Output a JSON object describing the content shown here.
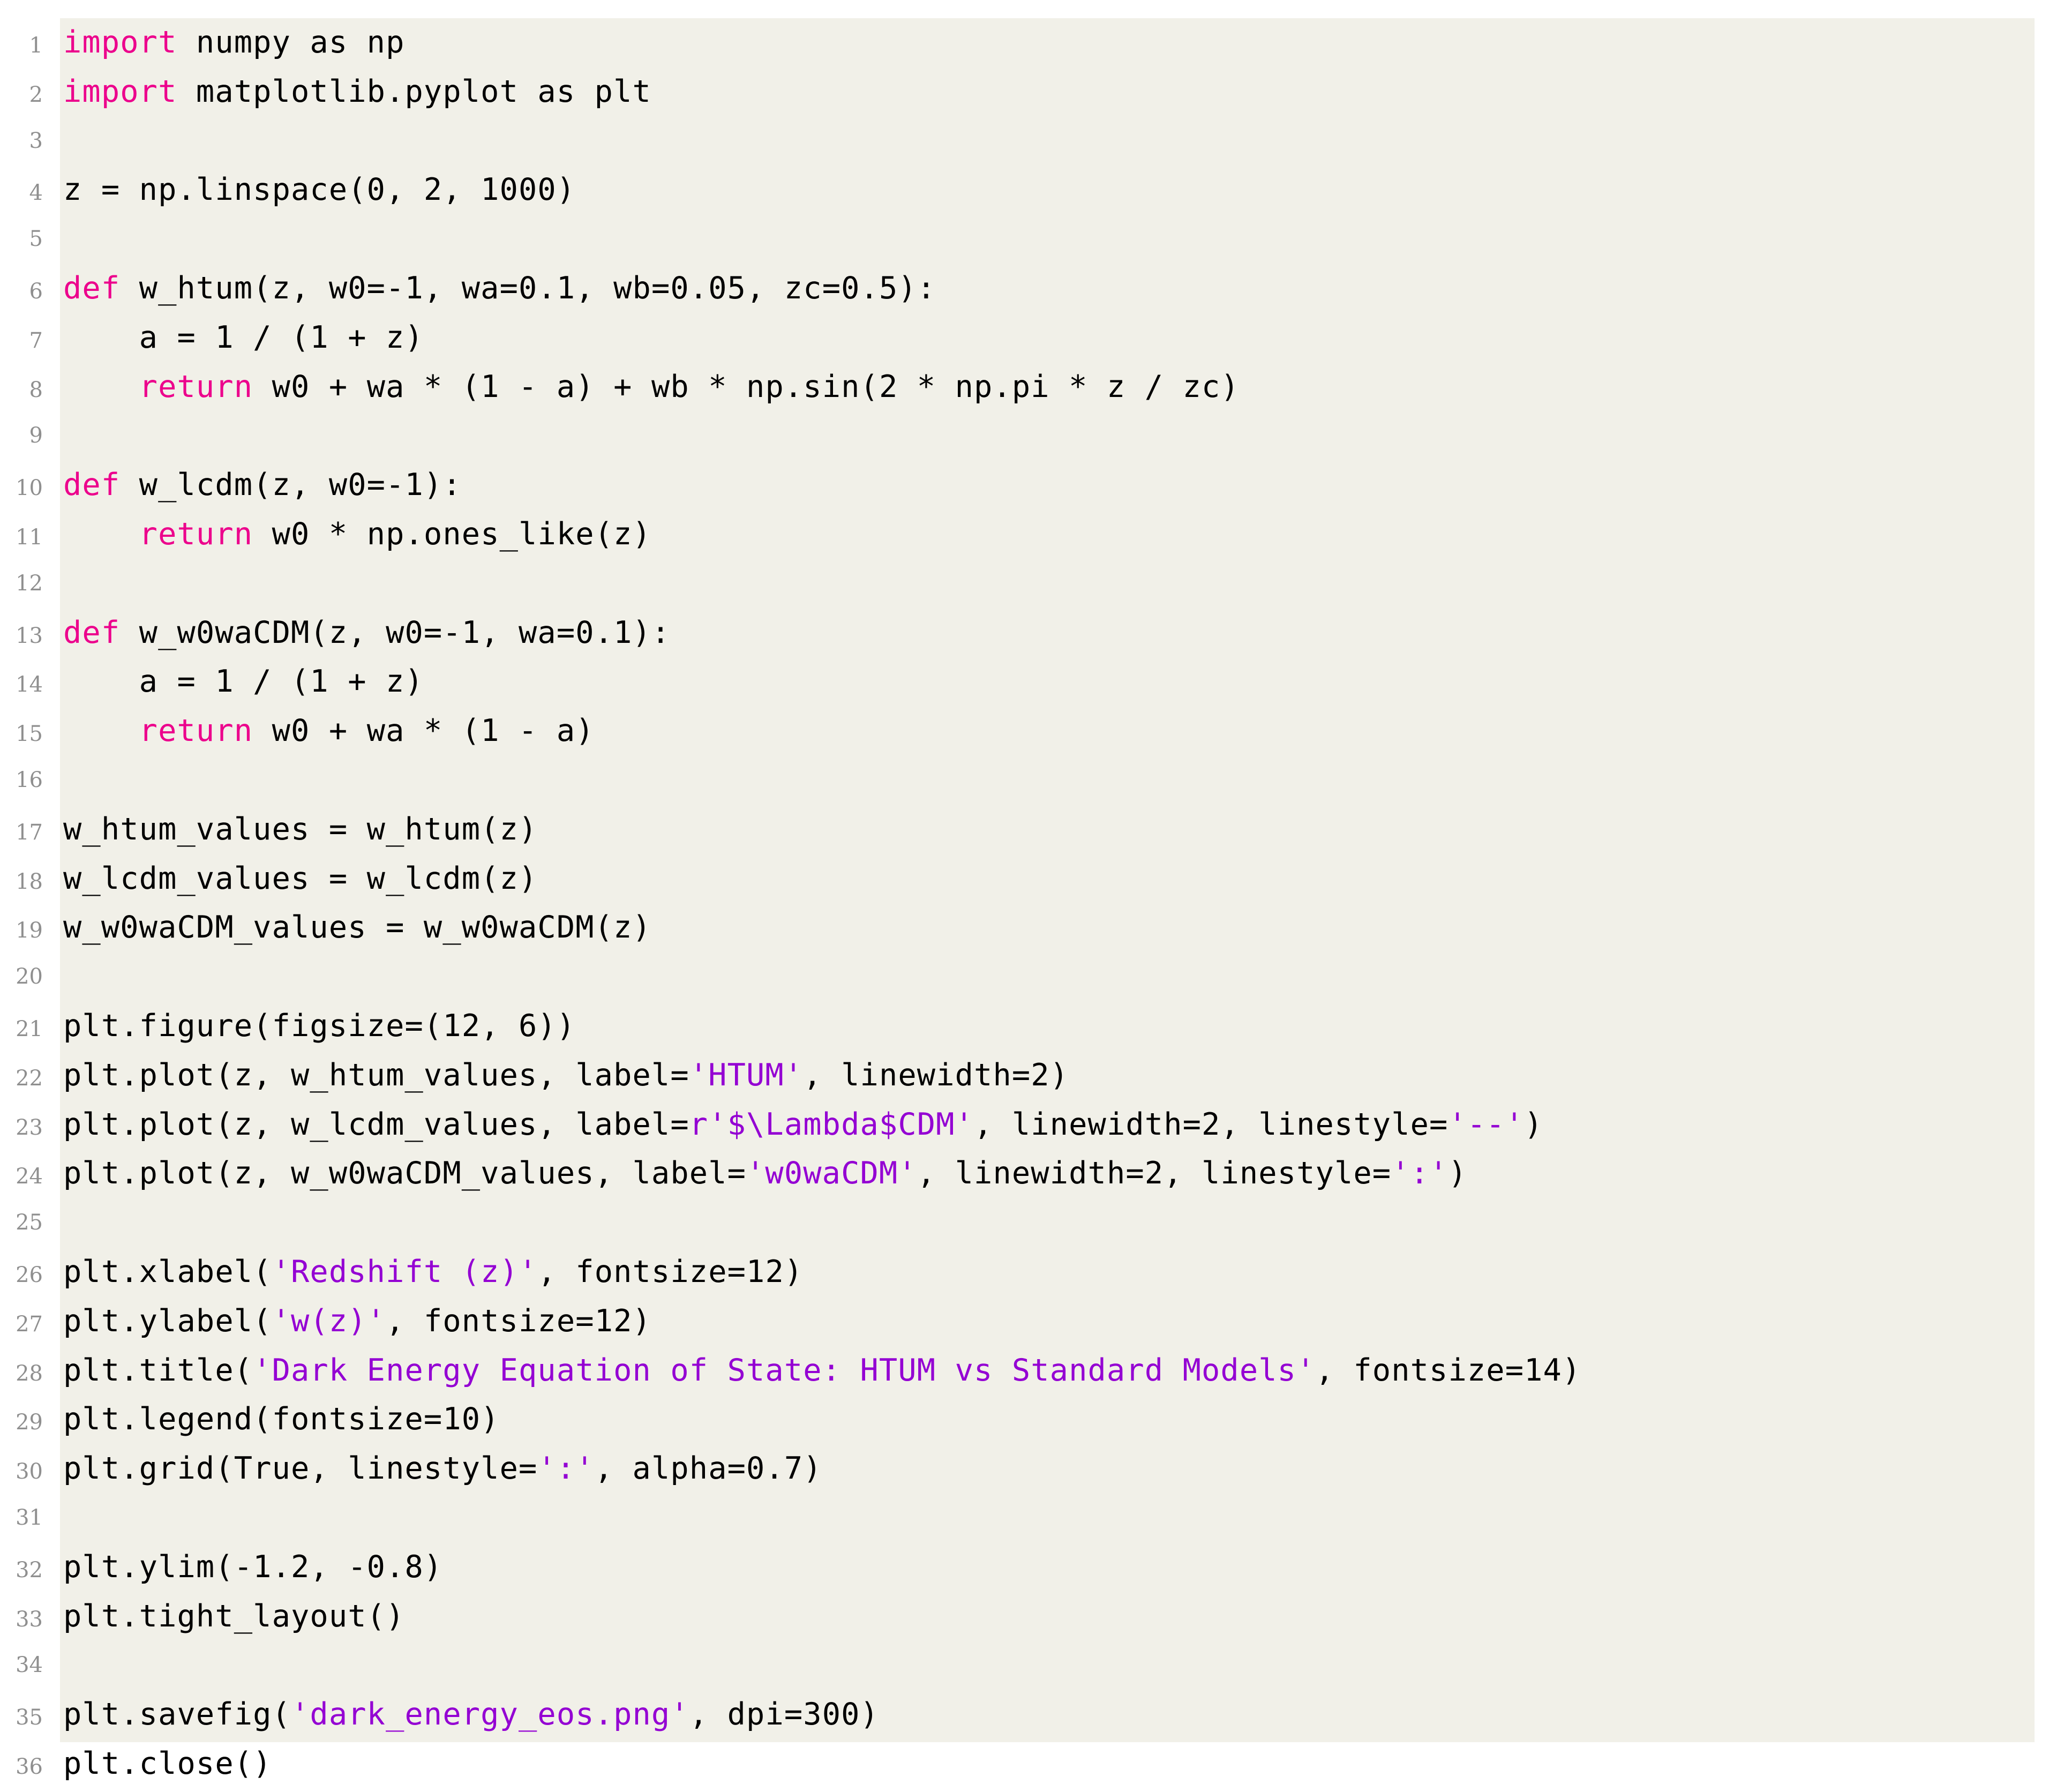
{
  "listing": {
    "language": "python",
    "background_color": "#f1f0e8",
    "keyword_color": "#ec008c",
    "string_color": "#9400d3",
    "text_color": "#000000",
    "lineno_color": "#8f8f8f",
    "line_count": 36,
    "lines": [
      {
        "n": "1",
        "tokens": [
          {
            "t": "import",
            "c": "kw"
          },
          {
            "t": " numpy as np",
            "c": "pl"
          }
        ]
      },
      {
        "n": "2",
        "tokens": [
          {
            "t": "import",
            "c": "kw"
          },
          {
            "t": " matplotlib.pyplot as plt",
            "c": "pl"
          }
        ]
      },
      {
        "n": "3",
        "tokens": []
      },
      {
        "n": "4",
        "tokens": [
          {
            "t": "z = np.linspace(0, 2, 1000)",
            "c": "pl"
          }
        ]
      },
      {
        "n": "5",
        "tokens": []
      },
      {
        "n": "6",
        "tokens": [
          {
            "t": "def",
            "c": "kw"
          },
          {
            "t": " w_htum(z, w0=-1, wa=0.1, wb=0.05, zc=0.5):",
            "c": "pl"
          }
        ]
      },
      {
        "n": "7",
        "tokens": [
          {
            "t": "    a = 1 / (1 + z)",
            "c": "pl"
          }
        ]
      },
      {
        "n": "8",
        "tokens": [
          {
            "t": "    ",
            "c": "pl"
          },
          {
            "t": "return",
            "c": "kw"
          },
          {
            "t": " w0 + wa * (1 - a) + wb * np.sin(2 * np.pi * z / zc)",
            "c": "pl"
          }
        ]
      },
      {
        "n": "9",
        "tokens": []
      },
      {
        "n": "10",
        "tokens": [
          {
            "t": "def",
            "c": "kw"
          },
          {
            "t": " w_lcdm(z, w0=-1):",
            "c": "pl"
          }
        ]
      },
      {
        "n": "11",
        "tokens": [
          {
            "t": "    ",
            "c": "pl"
          },
          {
            "t": "return",
            "c": "kw"
          },
          {
            "t": " w0 * np.ones_like(z)",
            "c": "pl"
          }
        ]
      },
      {
        "n": "12",
        "tokens": []
      },
      {
        "n": "13",
        "tokens": [
          {
            "t": "def",
            "c": "kw"
          },
          {
            "t": " w_w0waCDM(z, w0=-1, wa=0.1):",
            "c": "pl"
          }
        ]
      },
      {
        "n": "14",
        "tokens": [
          {
            "t": "    a = 1 / (1 + z)",
            "c": "pl"
          }
        ]
      },
      {
        "n": "15",
        "tokens": [
          {
            "t": "    ",
            "c": "pl"
          },
          {
            "t": "return",
            "c": "kw"
          },
          {
            "t": " w0 + wa * (1 - a)",
            "c": "pl"
          }
        ]
      },
      {
        "n": "16",
        "tokens": []
      },
      {
        "n": "17",
        "tokens": [
          {
            "t": "w_htum_values = w_htum(z)",
            "c": "pl"
          }
        ]
      },
      {
        "n": "18",
        "tokens": [
          {
            "t": "w_lcdm_values = w_lcdm(z)",
            "c": "pl"
          }
        ]
      },
      {
        "n": "19",
        "tokens": [
          {
            "t": "w_w0waCDM_values = w_w0waCDM(z)",
            "c": "pl"
          }
        ]
      },
      {
        "n": "20",
        "tokens": []
      },
      {
        "n": "21",
        "tokens": [
          {
            "t": "plt.figure(figsize=(12, 6))",
            "c": "pl"
          }
        ]
      },
      {
        "n": "22",
        "tokens": [
          {
            "t": "plt.plot(z, w_htum_values, label=",
            "c": "pl"
          },
          {
            "t": "'HTUM'",
            "c": "str"
          },
          {
            "t": ", linewidth=2)",
            "c": "pl"
          }
        ]
      },
      {
        "n": "23",
        "tokens": [
          {
            "t": "plt.plot(z, w_lcdm_values, label=",
            "c": "pl"
          },
          {
            "t": "r'$\\Lambda$CDM'",
            "c": "str"
          },
          {
            "t": ", linewidth=2, linestyle=",
            "c": "pl"
          },
          {
            "t": "'--'",
            "c": "str"
          },
          {
            "t": ")",
            "c": "pl"
          }
        ]
      },
      {
        "n": "24",
        "tokens": [
          {
            "t": "plt.plot(z, w_w0waCDM_values, label=",
            "c": "pl"
          },
          {
            "t": "'w0waCDM'",
            "c": "str"
          },
          {
            "t": ", linewidth=2, linestyle=",
            "c": "pl"
          },
          {
            "t": "':'",
            "c": "str"
          },
          {
            "t": ")",
            "c": "pl"
          }
        ]
      },
      {
        "n": "25",
        "tokens": []
      },
      {
        "n": "26",
        "tokens": [
          {
            "t": "plt.xlabel(",
            "c": "pl"
          },
          {
            "t": "'Redshift (z)'",
            "c": "str"
          },
          {
            "t": ", fontsize=12)",
            "c": "pl"
          }
        ]
      },
      {
        "n": "27",
        "tokens": [
          {
            "t": "plt.ylabel(",
            "c": "pl"
          },
          {
            "t": "'w(z)'",
            "c": "str"
          },
          {
            "t": ", fontsize=12)",
            "c": "pl"
          }
        ]
      },
      {
        "n": "28",
        "tokens": [
          {
            "t": "plt.title(",
            "c": "pl"
          },
          {
            "t": "'Dark Energy Equation of State: HTUM vs Standard Models'",
            "c": "str"
          },
          {
            "t": ", fontsize=14)",
            "c": "pl"
          }
        ]
      },
      {
        "n": "29",
        "tokens": [
          {
            "t": "plt.legend(fontsize=10)",
            "c": "pl"
          }
        ]
      },
      {
        "n": "30",
        "tokens": [
          {
            "t": "plt.grid(True, linestyle=",
            "c": "pl"
          },
          {
            "t": "':'",
            "c": "str"
          },
          {
            "t": ", alpha=0.7)",
            "c": "pl"
          }
        ]
      },
      {
        "n": "31",
        "tokens": []
      },
      {
        "n": "32",
        "tokens": [
          {
            "t": "plt.ylim(-1.2, -0.8)",
            "c": "pl"
          }
        ]
      },
      {
        "n": "33",
        "tokens": [
          {
            "t": "plt.tight_layout()",
            "c": "pl"
          }
        ]
      },
      {
        "n": "34",
        "tokens": []
      },
      {
        "n": "35",
        "tokens": [
          {
            "t": "plt.savefig(",
            "c": "pl"
          },
          {
            "t": "'dark_energy_eos.png'",
            "c": "str"
          },
          {
            "t": ", dpi=300)",
            "c": "pl"
          }
        ]
      },
      {
        "n": "36",
        "tokens": [
          {
            "t": "plt.close()",
            "c": "pl"
          }
        ]
      }
    ]
  }
}
